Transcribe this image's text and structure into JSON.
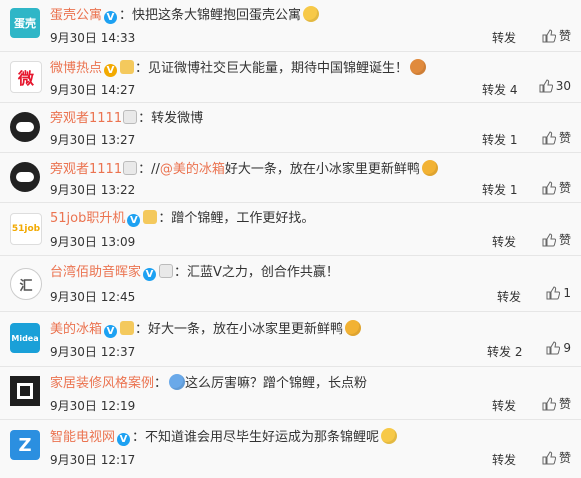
{
  "comments": [
    {
      "avatar_text": "蛋壳",
      "avatar_bg": "#2fb6c7",
      "user": "蛋壳公寓",
      "text": "快把这条大锦鲤抱回蛋壳公寓",
      "time": "9月30日 14:33",
      "repost": "转发",
      "like": "赞"
    },
    {
      "avatar_text": "微",
      "avatar_bg": "#e6162d",
      "user": "微博热点",
      "text": "见证微博社交巨大能量，期待中国锦鲤诞生！",
      "time": "9月30日 14:27",
      "repost": "转发 4",
      "like": "30"
    },
    {
      "avatar_text": "",
      "avatar_bg": "#222222",
      "user": "旁观者1111",
      "text": "转发微博",
      "time": "9月30日 13:27",
      "repost": "转发 1",
      "like": "赞"
    },
    {
      "avatar_text": "",
      "avatar_bg": "#222222",
      "user": "旁观者1111",
      "text_prefix": "//",
      "mention": "@美的冰箱",
      "text": "好大一条，放在小冰家里更新鲜鸭",
      "time": "9月30日 13:22",
      "repost": "转发 1",
      "like": "赞"
    },
    {
      "avatar_text": "51job",
      "avatar_bg": "#f2a900",
      "user": "51job职升机",
      "text": "蹭个锦鲤，工作更好找。",
      "time": "9月30日 13:09",
      "repost": "转发",
      "like": "赞"
    },
    {
      "avatar_text": "汇",
      "avatar_bg": "#555555",
      "user": "台湾佰助音晖家",
      "text": "汇蓝V之力，创合作共赢！",
      "time": "9月30日 12:45",
      "repost": "转发",
      "like": "1"
    },
    {
      "avatar_text": "Midea",
      "avatar_bg": "#1aa0d8",
      "user": "美的冰箱",
      "text": "好大一条，放在小冰家里更新鲜鸭",
      "time": "9月30日 12:37",
      "repost": "转发 2",
      "like": "9"
    },
    {
      "avatar_text": "",
      "avatar_bg": "#1e1e1e",
      "user": "家居装修风格案例",
      "text": "这么厉害嘛？蹭个锦鲤，长点粉",
      "time": "9月30日 12:19",
      "repost": "转发",
      "like": "赞"
    },
    {
      "avatar_text": "Z",
      "avatar_bg": "#2b8fe0",
      "user": "智能电视网",
      "text": "不知道谁会用尽毕生好运成为那条锦鲤呢",
      "time": "9月30日 12:17",
      "repost": "转发",
      "like": "赞"
    }
  ]
}
